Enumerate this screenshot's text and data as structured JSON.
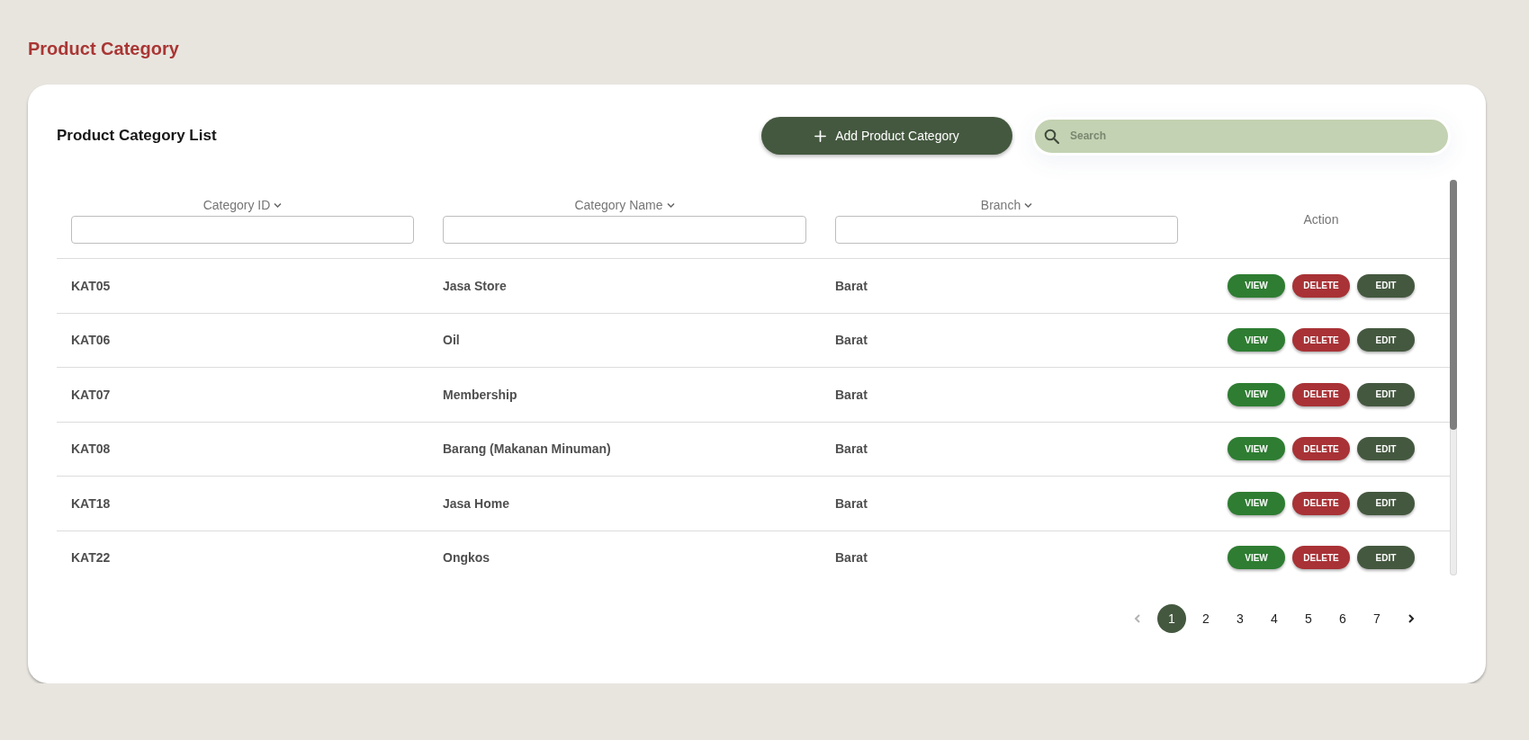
{
  "page": {
    "title": "Product Category"
  },
  "card": {
    "title": "Product Category List",
    "add_button": {
      "label": "Add Product Category"
    },
    "search": {
      "placeholder": "Search"
    }
  },
  "table": {
    "columns": [
      {
        "label": "Category ID",
        "kind": "filter"
      },
      {
        "label": "Category Name",
        "kind": "filter"
      },
      {
        "label": "Branch",
        "kind": "filter"
      },
      {
        "label": "Action",
        "kind": "plain"
      }
    ],
    "rows": [
      {
        "cells": [
          "KAT05",
          "Jasa Store",
          "Barat"
        ],
        "actions": [
          {
            "label": "VIEW",
            "kind": "view"
          },
          {
            "label": "DELETE",
            "kind": "delete"
          },
          {
            "label": "EDIT",
            "kind": "edit"
          }
        ]
      },
      {
        "cells": [
          "KAT06",
          "Oil",
          "Barat"
        ],
        "actions": [
          {
            "label": "VIEW",
            "kind": "view"
          },
          {
            "label": "DELETE",
            "kind": "delete"
          },
          {
            "label": "EDIT",
            "kind": "edit"
          }
        ]
      },
      {
        "cells": [
          "KAT07",
          "Membership",
          "Barat"
        ],
        "actions": [
          {
            "label": "VIEW",
            "kind": "view"
          },
          {
            "label": "DELETE",
            "kind": "delete"
          },
          {
            "label": "EDIT",
            "kind": "edit"
          }
        ]
      },
      {
        "cells": [
          "KAT08",
          "Barang (Makanan Minuman)",
          "Barat"
        ],
        "actions": [
          {
            "label": "VIEW",
            "kind": "view"
          },
          {
            "label": "DELETE",
            "kind": "delete"
          },
          {
            "label": "EDIT",
            "kind": "edit"
          }
        ]
      },
      {
        "cells": [
          "KAT18",
          "Jasa Home",
          "Barat"
        ],
        "actions": [
          {
            "label": "VIEW",
            "kind": "view"
          },
          {
            "label": "DELETE",
            "kind": "delete"
          },
          {
            "label": "EDIT",
            "kind": "edit"
          }
        ]
      },
      {
        "cells": [
          "KAT22",
          "Ongkos",
          "Barat"
        ],
        "actions": [
          {
            "label": "VIEW",
            "kind": "view"
          },
          {
            "label": "DELETE",
            "kind": "delete"
          },
          {
            "label": "EDIT",
            "kind": "edit"
          }
        ]
      }
    ]
  },
  "pagination": {
    "previous": {
      "disabled": true
    },
    "pages": [
      {
        "label": "1",
        "selected": true
      },
      {
        "label": "2",
        "selected": false
      },
      {
        "label": "3",
        "selected": false
      },
      {
        "label": "4",
        "selected": false
      },
      {
        "label": "5",
        "selected": false
      },
      {
        "label": "6",
        "selected": false
      },
      {
        "label": "7",
        "selected": false
      }
    ],
    "next": {
      "disabled": false
    }
  }
}
